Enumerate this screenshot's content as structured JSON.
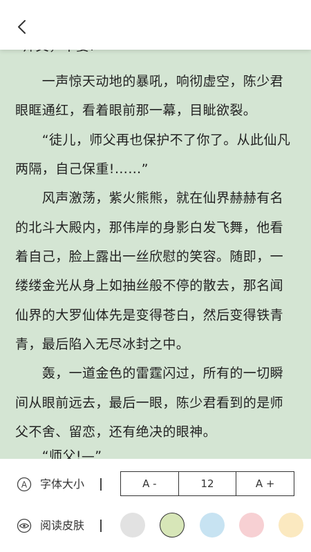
{
  "content": {
    "paragraphs": [
      "“师父，不要!—”",
      "　　一声惊天动地的暴吼，响彻虚空，陈少君",
      "眼眶通红，看着眼前那一幕，目眦欲裂。",
      "　　“徒儿，师父再也保护不了你了。从此仙凡",
      "两隔，自己保重!……”",
      "　　风声激荡，紫火熊熊，就在仙界赫赫有名",
      "的北斗大殿内，那伟岸的身影白发飞舞，他看",
      "着自己，脸上露出一丝欣慰的笑容。随即，一",
      "缕缕金光从身上如抽丝般不停的散去，那名闻",
      "仙界的大罗仙体先是变得苍白，然后变得铁青",
      "青，最后陷入无尽冰封之中。",
      "　　轰，一道金色的雷霆闪过，所有的一切瞬",
      "间从眼前远去，最后一眼，陈少君看到的是师",
      "父不舍、留恋，还有绝决的眼神。",
      "　　“师父!—”"
    ]
  },
  "settings": {
    "font": {
      "icon": "letter-a-icon",
      "icon_text": "A",
      "label": "字体大小",
      "separator": "|",
      "decrease": "A -",
      "size": "12",
      "increase": "A +"
    },
    "skin": {
      "icon": "eye-icon",
      "label": "阅读皮肤",
      "separator": "|",
      "colors": [
        "#e2e2e2",
        "#d7e6b8",
        "#c7e3f2",
        "#f7d0d3",
        "#fbe9c0"
      ],
      "selected_index": 1
    }
  },
  "theme": {
    "reading_background": "#d4e5d3",
    "text_color": "#222222"
  }
}
